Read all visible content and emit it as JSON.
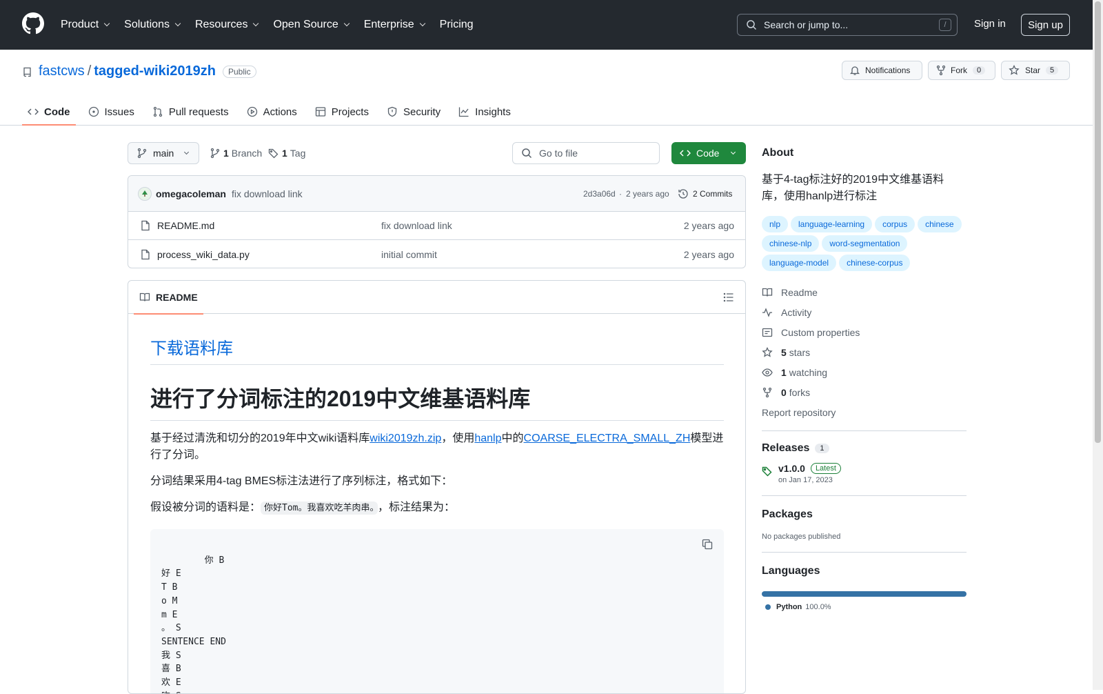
{
  "topbar": {
    "nav": [
      "Product",
      "Solutions",
      "Resources",
      "Open Source",
      "Enterprise",
      "Pricing"
    ],
    "search_placeholder": "Search or jump to...",
    "search_shortcut": "/",
    "sign_in": "Sign in",
    "sign_up": "Sign up"
  },
  "repo": {
    "owner": "fastcws",
    "separator": "/",
    "name": "tagged-wiki2019zh",
    "visibility": "Public",
    "notifications_label": "Notifications",
    "fork_label": "Fork",
    "fork_count": "0",
    "star_label": "Star",
    "star_count": "5"
  },
  "tabs": [
    "Code",
    "Issues",
    "Pull requests",
    "Actions",
    "Projects",
    "Security",
    "Insights"
  ],
  "toolbar": {
    "branch": "main",
    "branches_count": "1",
    "branches_label": "Branch",
    "tags_count": "1",
    "tags_label": "Tag",
    "go_to_file": "Go to file",
    "code_button": "Code"
  },
  "commit": {
    "author": "omegacoleman",
    "message": "fix download link",
    "hash": "2d3a06d",
    "dot": "·",
    "time": "2 years ago",
    "commits_label": "2 Commits"
  },
  "files": [
    {
      "name": "README.md",
      "message": "fix download link",
      "time": "2 years ago"
    },
    {
      "name": "process_wiki_data.py",
      "message": "initial commit",
      "time": "2 years ago"
    }
  ],
  "readme": {
    "tab_label": "README",
    "h2": "下载语料库",
    "h1": "进行了分词标注的2019中文维基语料库",
    "p1_a": "基于经过清洗和切分的2019年中文wiki语料库",
    "p1_link1": "wiki2019zh.zip",
    "p1_b": "，使用",
    "p1_link2": "hanlp",
    "p1_c": "中的",
    "p1_link3": "COARSE_ELECTRA_SMALL_ZH",
    "p1_d": "模型进行了分词。",
    "p2": "分词结果采用4-tag BMES标注法进行了序列标注，格式如下：",
    "p3_a": "假设被分词的语料是：",
    "p3_code": "你好Tom。我喜欢吃羊肉串。",
    "p3_b": "，标注结果为：",
    "code_block": "你 B\n好 E\nT B\no M\nm E\n。 S\nSENTENCE END\n我 S\n喜 B\n欢 E\n吃 S\n羊 B"
  },
  "about": {
    "title": "About",
    "description": "基于4-tag标注好的2019中文维基语料库，使用hanlp进行标注",
    "topics": [
      "nlp",
      "language-learning",
      "corpus",
      "chinese",
      "chinese-nlp",
      "word-segmentation",
      "language-model",
      "chinese-corpus"
    ],
    "readme": "Readme",
    "activity": "Activity",
    "custom_properties": "Custom properties",
    "stars_count": "5",
    "stars_label": "stars",
    "watching_count": "1",
    "watching_label": "watching",
    "forks_count": "0",
    "forks_label": "forks",
    "report": "Report repository"
  },
  "releases": {
    "title": "Releases",
    "count": "1",
    "version": "v1.0.0",
    "badge": "Latest",
    "date": "on Jan 17, 2023"
  },
  "packages": {
    "title": "Packages",
    "text": "No packages published"
  },
  "languages": {
    "title": "Languages",
    "items": [
      {
        "name": "Python",
        "percent": "100.0%",
        "fraction": 1.0,
        "color": "#3572A5"
      }
    ]
  }
}
